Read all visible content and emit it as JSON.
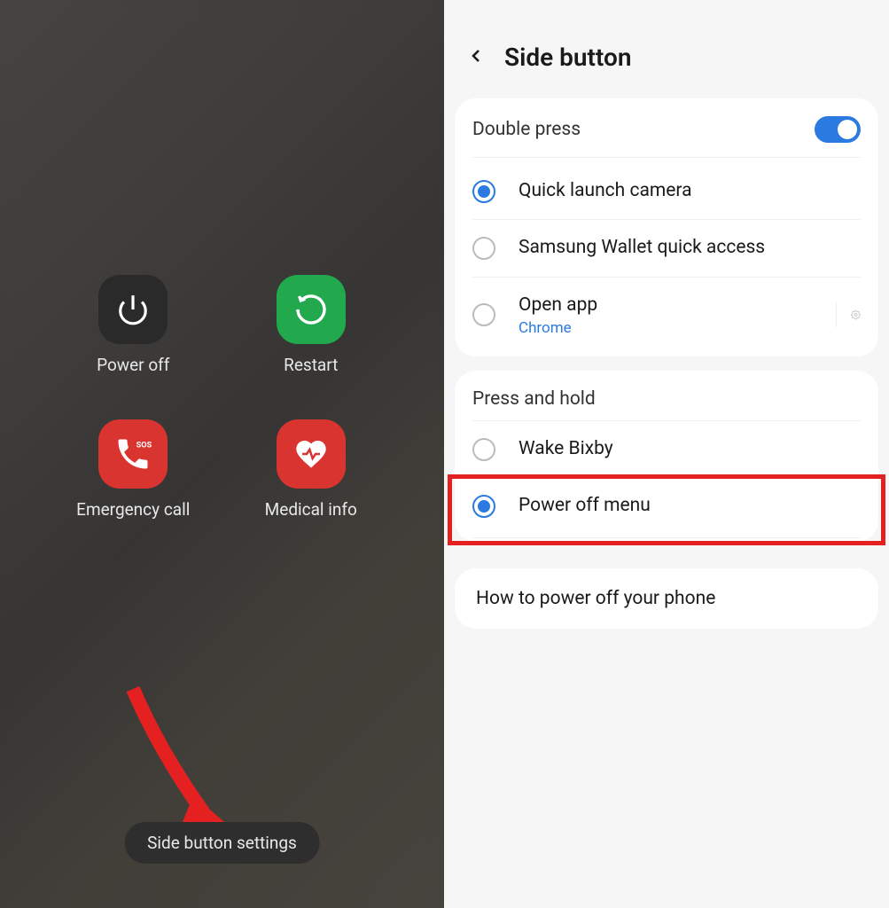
{
  "left_panel": {
    "power_items": [
      {
        "id": "power-off",
        "label": "Power off",
        "color": "dark",
        "icon": "power"
      },
      {
        "id": "restart",
        "label": "Restart",
        "color": "green",
        "icon": "restart"
      },
      {
        "id": "emergency-call",
        "label": "Emergency call",
        "color": "red",
        "icon": "sos-phone"
      },
      {
        "id": "medical-info",
        "label": "Medical info",
        "color": "red",
        "icon": "heart"
      }
    ],
    "bottom_button": "Side button settings"
  },
  "right_panel": {
    "header_title": "Side button",
    "section1": {
      "title": "Double press",
      "toggle_on": true,
      "options": [
        {
          "label": "Quick launch camera",
          "selected": true,
          "sublabel": ""
        },
        {
          "label": "Samsung Wallet quick access",
          "selected": false,
          "sublabel": ""
        },
        {
          "label": "Open app",
          "selected": false,
          "sublabel": "Chrome",
          "has_gear": true
        }
      ]
    },
    "section2": {
      "title": "Press and hold",
      "options": [
        {
          "label": "Wake Bixby",
          "selected": false,
          "highlighted": false
        },
        {
          "label": "Power off menu",
          "selected": true,
          "highlighted": true
        }
      ]
    },
    "info_row": "How to power off your phone"
  }
}
